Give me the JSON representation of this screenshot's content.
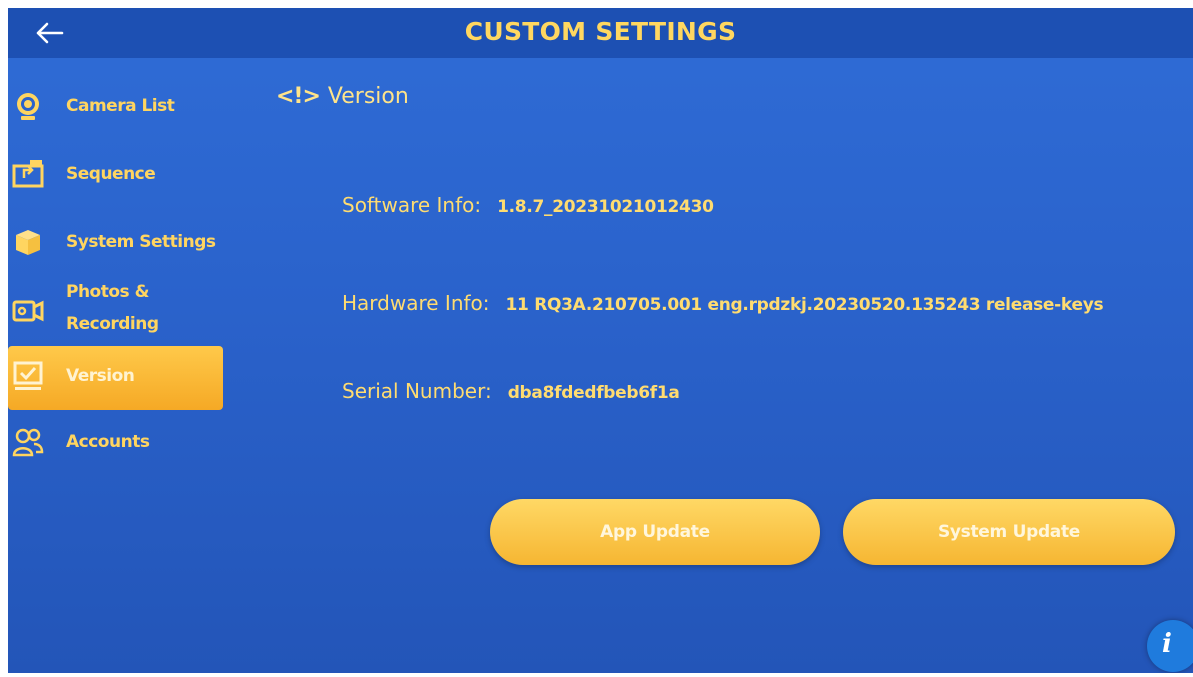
{
  "header": {
    "title": "CUSTOM SETTINGS",
    "back_icon": "back-arrow-icon"
  },
  "sidebar": {
    "items": [
      {
        "label": "Camera List",
        "icon": "webcam-icon",
        "active": false
      },
      {
        "label": "Sequence",
        "icon": "sequence-icon",
        "active": false
      },
      {
        "label": "System Settings",
        "icon": "box-icon",
        "active": false
      },
      {
        "label": "Photos & Recording",
        "icon": "video-camera-icon",
        "active": false
      },
      {
        "label": "Version",
        "icon": "version-icon",
        "active": true
      },
      {
        "label": "Accounts",
        "icon": "users-icon",
        "active": false
      }
    ]
  },
  "section": {
    "tag": "<!>",
    "title": "Version"
  },
  "info": {
    "software_label": "Software Info:",
    "software_value": "1.8.7_20231021012430",
    "hardware_label": "Hardware Info:",
    "hardware_value": "11 RQ3A.210705.001 eng.rpdzkj.20230520.135243 release-keys",
    "serial_label": "Serial Number:",
    "serial_value": "dba8fdedfbeb6f1a"
  },
  "buttons": {
    "app_update": "App Update",
    "system_update": "System Update"
  },
  "fab": {
    "label": "i",
    "icon": "info-icon"
  },
  "colors": {
    "accent": "#ffd560",
    "background": "#2a62cb",
    "header": "#1d50b3",
    "active_item": "#f5a925"
  }
}
